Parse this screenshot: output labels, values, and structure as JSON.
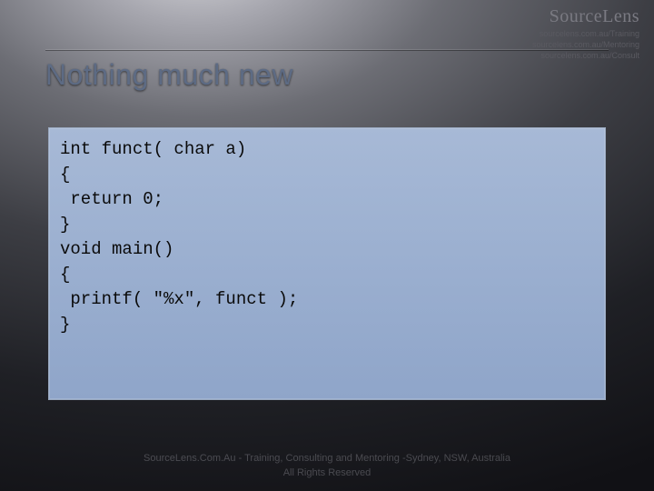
{
  "watermark": {
    "brand": "SourceLens",
    "links": [
      "sourcelens.com.au/Training",
      "sourcelens.com.au/Mentoring",
      "sourcelens.com.au/Consult"
    ]
  },
  "title": "Nothing much new",
  "code": "int funct( char a)\n{\n return 0;\n}\nvoid main()\n{\n printf( \"%x\", funct );\n}",
  "footer": {
    "line1": "SourceLens.Com.Au - Training, Consulting and Mentoring -Sydney, NSW, Australia",
    "line2": "All Rights Reserved"
  }
}
